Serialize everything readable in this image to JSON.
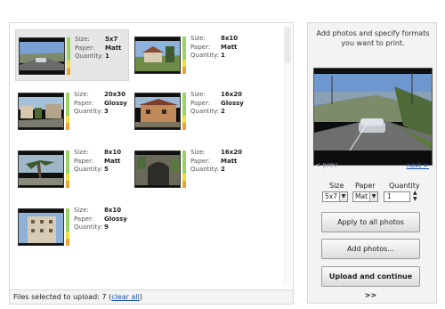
{
  "photos": [
    {
      "size": "5x7",
      "paper": "Matt",
      "quantity": "1",
      "selected": true,
      "scene": "road"
    },
    {
      "size": "8x10",
      "paper": "Matt",
      "quantity": "1",
      "selected": false,
      "scene": "house"
    },
    {
      "size": "20x30",
      "paper": "Glossy",
      "quantity": "3",
      "selected": false,
      "scene": "village"
    },
    {
      "size": "16x20",
      "paper": "Glossy",
      "quantity": "2",
      "selected": false,
      "scene": "building"
    },
    {
      "size": "8x10",
      "paper": "Matt",
      "quantity": "5",
      "selected": false,
      "scene": "palm"
    },
    {
      "size": "16x20",
      "paper": "Matt",
      "quantity": "2",
      "selected": false,
      "scene": "arch"
    },
    {
      "size": "8x10",
      "paper": "Glossy",
      "quantity": "9",
      "selected": false,
      "scene": "tower"
    }
  ],
  "labels": {
    "size": "Size:",
    "paper": "Paper:",
    "quantity": "Quantity:"
  },
  "status": {
    "text": "Files selected to upload: 7 (",
    "link": "clear all",
    "suffix": ")"
  },
  "sidebar": {
    "instructions": "Add photos and specify formats you want to print.",
    "prev": "< prev",
    "next": "next >",
    "size_label": "Size",
    "paper_label": "Paper",
    "quantity_label": "Quantity",
    "size_value": "5x7",
    "paper_value": "Mat",
    "quantity_value": "1",
    "apply_button": "Apply to all photos",
    "add_button": "Add photos...",
    "upload_button": "Upload and continue >>"
  },
  "colors": {
    "link": "#1a4fb0",
    "level_green": "#9bd266",
    "level_yellow": "#f3dd45",
    "level_orange": "#e8a535"
  }
}
